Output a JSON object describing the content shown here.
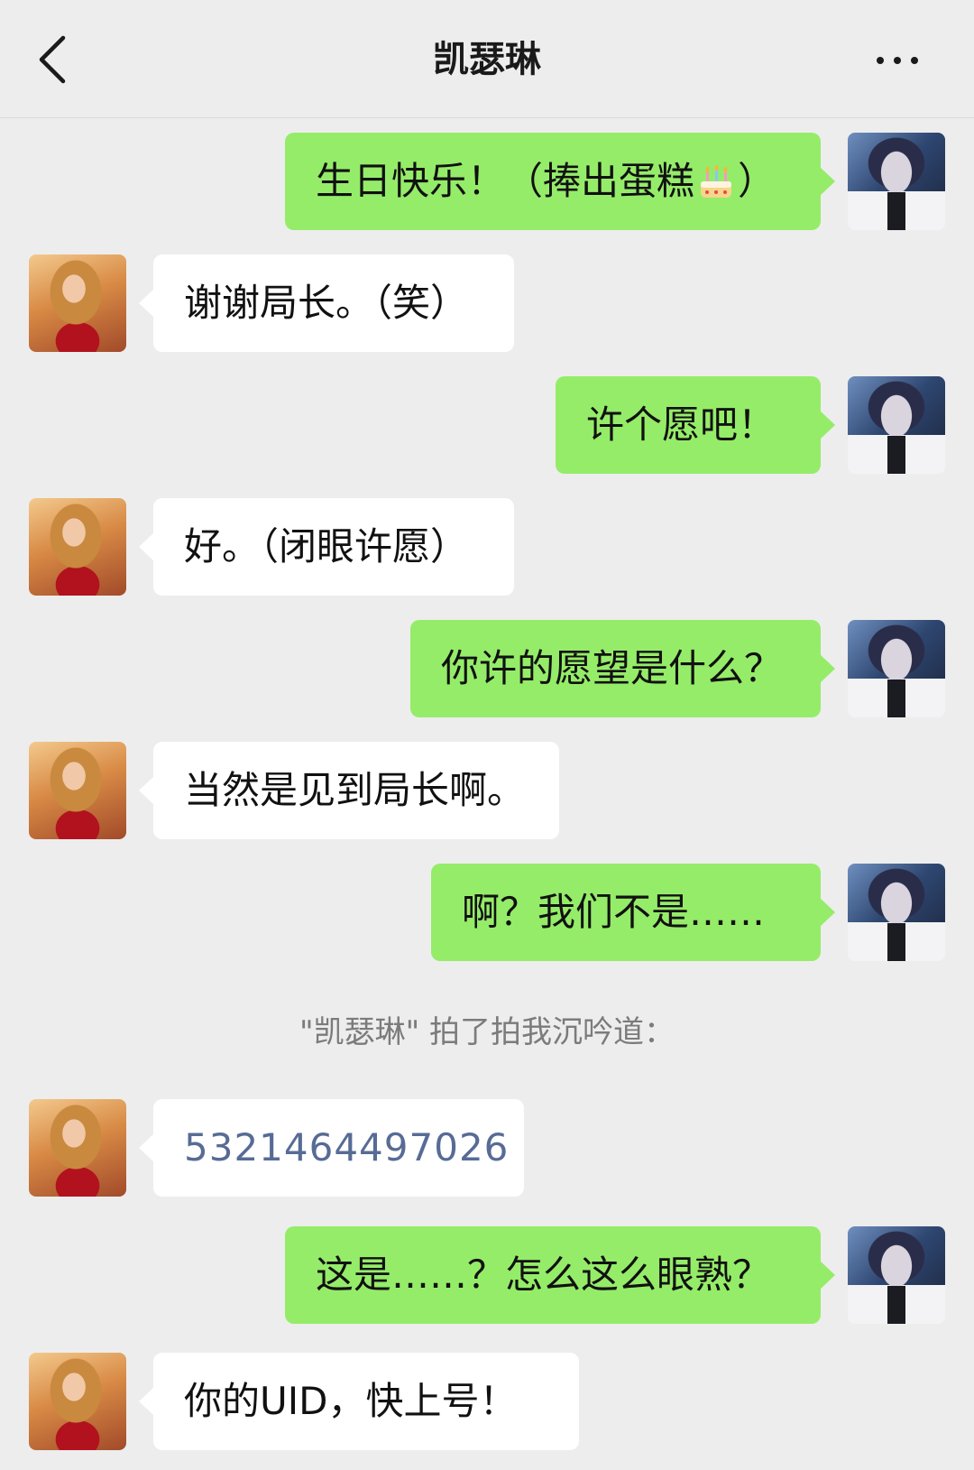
{
  "header": {
    "title": "凯瑟琳",
    "back_icon": "chevron-left-icon",
    "more_icon": "more-icon"
  },
  "colors": {
    "background": "#ededed",
    "sent_bubble": "#95ec69",
    "received_bubble": "#ffffff",
    "link_text": "#576b95",
    "system_text": "#7b7b7b"
  },
  "messages": [
    {
      "from": "me",
      "text_before": "生日快乐！（捧出蛋糕",
      "emoji": "birthday-cake-icon",
      "text_after": "）"
    },
    {
      "from": "her",
      "text": "谢谢局长。（笑）"
    },
    {
      "from": "me",
      "text": "许个愿吧！"
    },
    {
      "from": "her",
      "text": "好。（闭眼许愿）"
    },
    {
      "from": "me",
      "text": "你许的愿望是什么？"
    },
    {
      "from": "her",
      "text": "当然是见到局长啊。"
    },
    {
      "from": "me",
      "text": "啊？我们不是……"
    },
    {
      "from": "system",
      "text": "\"凯瑟琳\" 拍了拍我沉吟道："
    },
    {
      "from": "her",
      "text": "5321464497026",
      "is_link": true
    },
    {
      "from": "me",
      "text": "这是……？怎么这么眼熟？"
    },
    {
      "from": "her",
      "text": "你的UID，快上号！"
    }
  ]
}
